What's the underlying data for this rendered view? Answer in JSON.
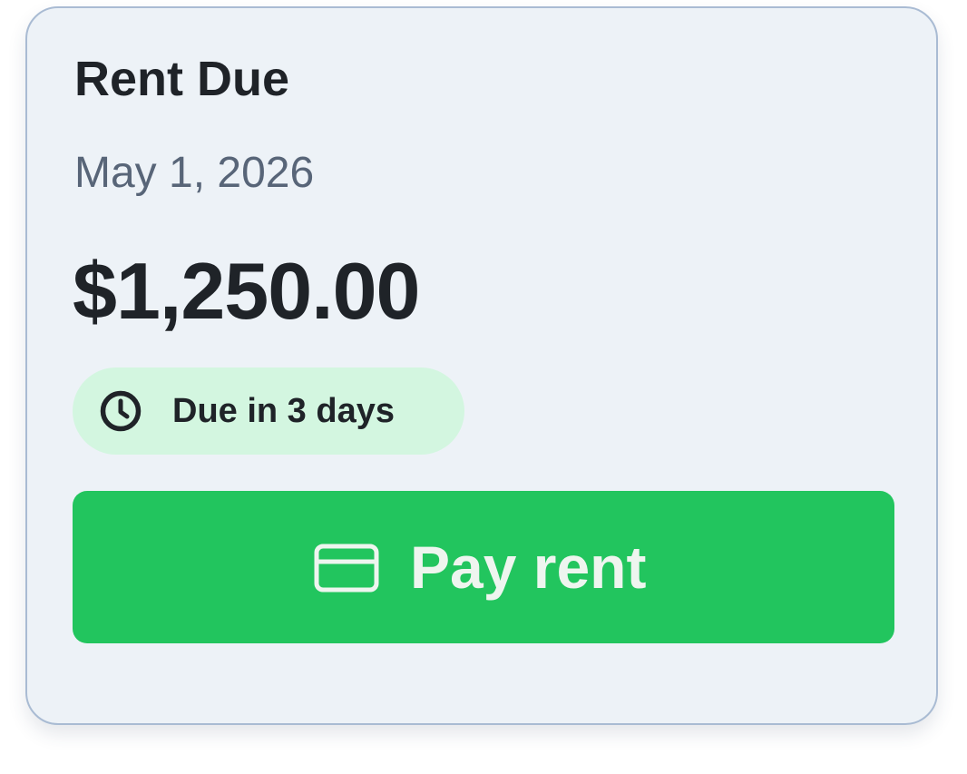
{
  "card": {
    "title": "Rent Due",
    "date": "May 1, 2026",
    "amount": "$1,250.00",
    "badge": {
      "icon": "clock-icon",
      "label": "Due in 3 days"
    },
    "button": {
      "icon": "credit-card-icon",
      "label": "Pay rent"
    }
  },
  "colors": {
    "card_background": "#edf2f7",
    "card_border": "#a9bbd3",
    "badge_background": "#d3f6e0",
    "button_background": "#22c55e",
    "text_primary": "#1f2328",
    "text_secondary": "#586578"
  }
}
